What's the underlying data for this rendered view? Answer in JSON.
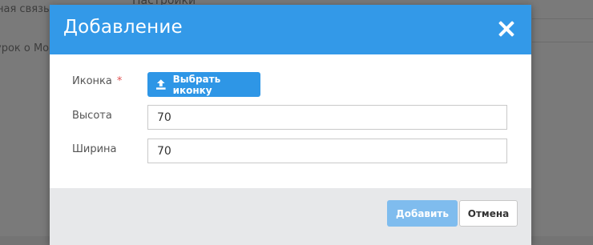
{
  "background": {
    "feedback_text": "ная связь",
    "settings_text": "Настройки",
    "hint_text": "урок о Мо"
  },
  "modal": {
    "title": "Добавление",
    "fields": {
      "icon_label": "Иконка",
      "required_mark": "*",
      "upload_button": "Выбрать иконку",
      "height_label": "Высота",
      "height_value": "70",
      "width_label": "Ширина",
      "width_value": "70"
    },
    "footer": {
      "add_button": "Добавить",
      "cancel_button": "Отмена"
    }
  },
  "colors": {
    "header": "#3399e8",
    "primary_button": "#2e96e6",
    "add_button_disabled": "#7fbcee",
    "required": "#e05252",
    "footer": "#e7e8ea"
  },
  "icons": {
    "close": "close-icon",
    "upload": "upload-icon"
  }
}
